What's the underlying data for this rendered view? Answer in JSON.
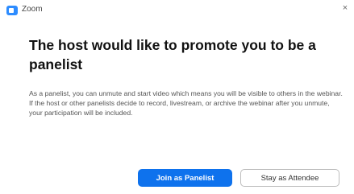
{
  "window": {
    "title": "Zoom",
    "close_glyph": "×",
    "icon": "zoom-app-icon"
  },
  "dialog": {
    "headline": "The host would like to promote you to be a panelist",
    "paragraph_1": "As a panelist, you can unmute and start video which means you will be visible to others in the webinar.",
    "paragraph_2": "If the host or other panelists decide to record, livestream, or archive the webinar after you unmute, your participation will be included."
  },
  "actions": {
    "primary_label": "Join as Panelist",
    "secondary_label": "Stay as Attendee"
  },
  "colors": {
    "primary": "#0e72ed",
    "app_icon": "#2d8cff"
  }
}
